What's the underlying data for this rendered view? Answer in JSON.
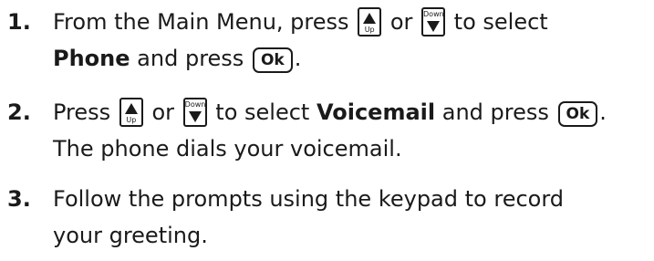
{
  "steps": [
    {
      "number": "1.",
      "text_a": "From the Main Menu, press",
      "text_or": "or",
      "text_b": "to select",
      "bold": "Phone",
      "text_c": "and press",
      "ok": "Ok",
      "end": "."
    },
    {
      "number": "2.",
      "text_a": "Press",
      "text_or": "or",
      "text_b": "to select",
      "bold": "Voicemail",
      "text_c": "and press",
      "ok": "Ok",
      "end": ".",
      "line2": "The phone dials your voicemail."
    },
    {
      "number": "3.",
      "line1": "Follow the prompts using the keypad to record",
      "line2": "your greeting."
    }
  ],
  "keys": {
    "up_label": "Up",
    "down_label": "Down",
    "up_icon": "up-arrow-key-icon",
    "down_icon": "down-arrow-key-icon"
  }
}
